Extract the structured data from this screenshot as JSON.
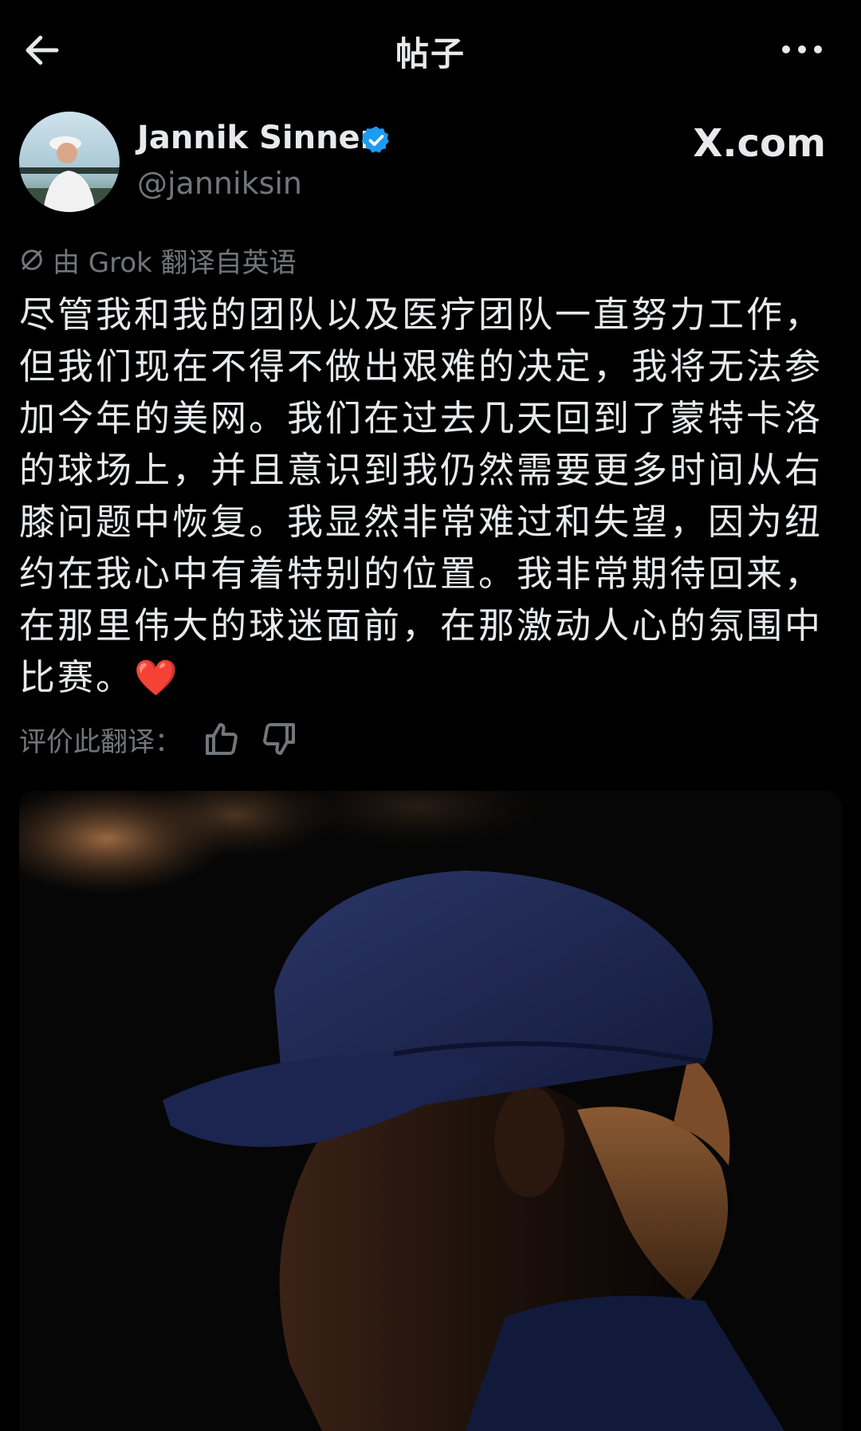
{
  "header": {
    "title": "帖子"
  },
  "author": {
    "name": "Jannik Sinner",
    "handle": "@janniksin",
    "site_label": "X.com",
    "verified_color": "#1d9bf0"
  },
  "translation": {
    "label": "由 Grok 翻译自英语",
    "rate_label": "评价此翻译："
  },
  "post": {
    "text": "尽管我和我的团队以及医疗团队一直努力工作，\n但我们现在不得不做出艰难的决定，我将无法参\n加今年的美网。我们在过去几天回到了蒙特卡洛\n的球场上，并且意识到我仍然需要更多时间从右\n膝问题中恢复。我显然非常难过和失望，因为纽\n约在我心中有着特别的位置。我非常期待回来，\n在那里伟大的球迷面前，在那激动人心的氛围中\n比赛。",
    "emoji": "❤️"
  },
  "icons": {
    "back": "back-arrow-icon",
    "more": "more-icon",
    "verified": "verified-badge-icon",
    "translate": "translate-icon",
    "thumb_up": "thumbs-up-icon",
    "thumb_down": "thumbs-down-icon"
  }
}
